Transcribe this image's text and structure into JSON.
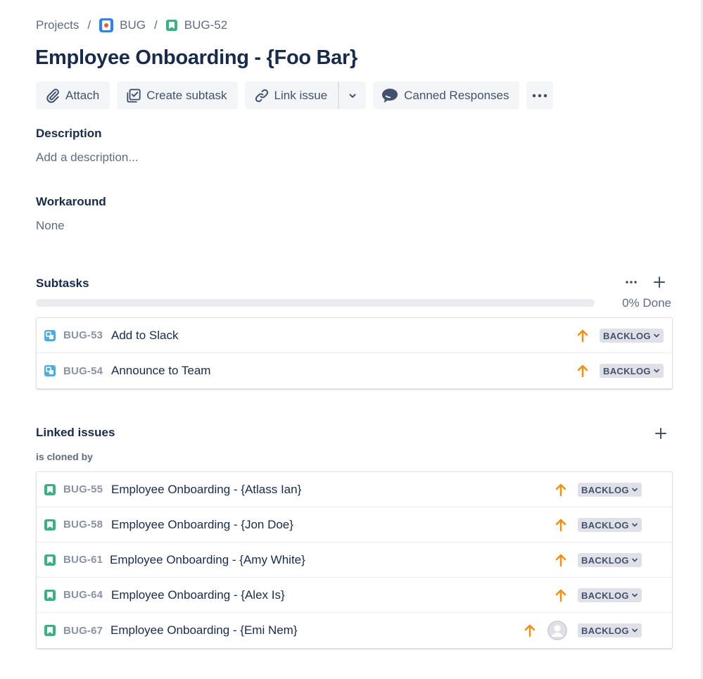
{
  "breadcrumb": {
    "projects": "Projects",
    "separator": "/",
    "project": "BUG",
    "issue_key": "BUG-52"
  },
  "issue": {
    "title": "Employee Onboarding - {Foo Bar}"
  },
  "toolbar": {
    "attach": "Attach",
    "create_subtask": "Create subtask",
    "link_issue": "Link issue",
    "canned_responses": "Canned Responses"
  },
  "description": {
    "label": "Description",
    "placeholder": "Add a description..."
  },
  "workaround": {
    "label": "Workaround",
    "value": "None"
  },
  "subtasks": {
    "label": "Subtasks",
    "progress_fraction": 0,
    "progress_text": "0% Done",
    "items": [
      {
        "key": "BUG-53",
        "summary": "Add to Slack",
        "priority": "high-arrow-icon",
        "status": "BACKLOG"
      },
      {
        "key": "BUG-54",
        "summary": "Announce to Team",
        "priority": "high-arrow-icon",
        "status": "BACKLOG"
      }
    ]
  },
  "linked_issues": {
    "label": "Linked issues",
    "relation": "is cloned by",
    "items": [
      {
        "key": "BUG-55",
        "summary": "Employee Onboarding - {Atlass Ian}",
        "status": "BACKLOG"
      },
      {
        "key": "BUG-58",
        "summary": "Employee Onboarding - {Jon Doe}",
        "status": "BACKLOG"
      },
      {
        "key": "BUG-61",
        "summary": "Employee Onboarding - {Amy White}",
        "status": "BACKLOG"
      },
      {
        "key": "BUG-64",
        "summary": "Employee Onboarding - {Alex Is}",
        "status": "BACKLOG"
      },
      {
        "key": "BUG-67",
        "summary": "Employee Onboarding - {Emi Nem}",
        "status": "BACKLOG"
      }
    ]
  },
  "colors": {
    "priority_high": "#ff8b00",
    "story_green": "#36b37e",
    "subtask_blue": "#4bade8",
    "status_bg": "#dfe1e6",
    "text_primary": "#172b4d",
    "text_muted": "#5e6c84"
  }
}
